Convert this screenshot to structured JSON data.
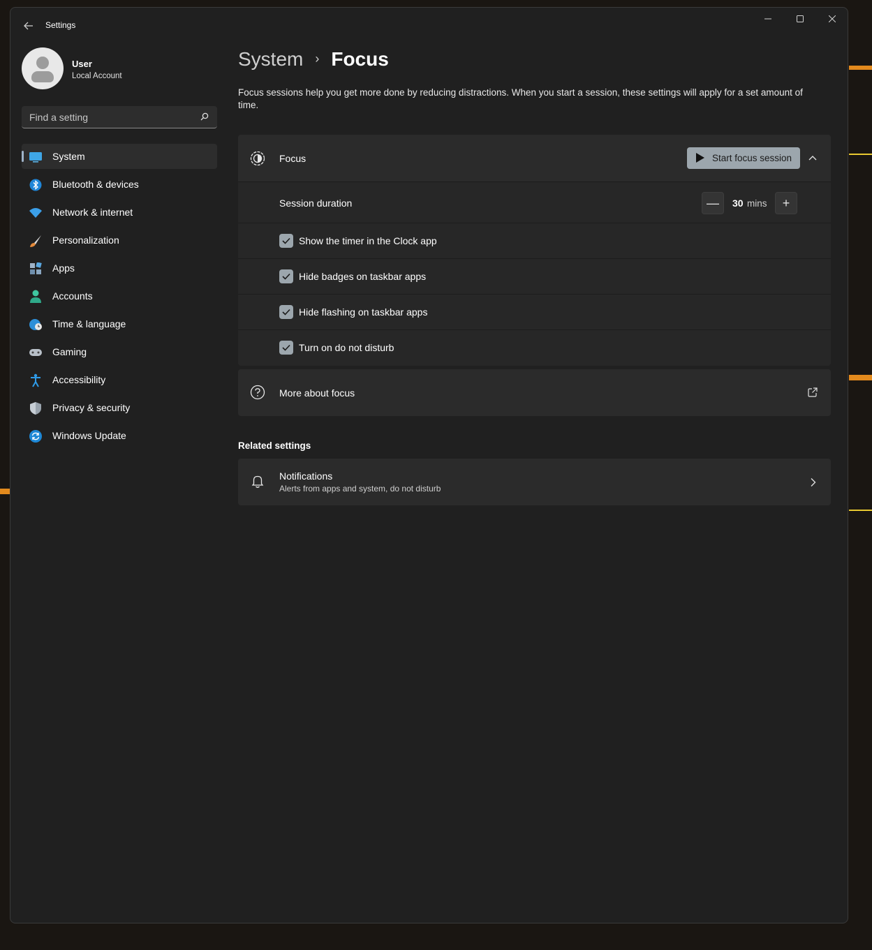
{
  "window": {
    "title": "Settings",
    "back_icon": "back-arrow-icon",
    "controls": [
      "minimize-icon",
      "maximize-icon",
      "close-icon"
    ]
  },
  "profile": {
    "name": "User",
    "account_type": "Local Account"
  },
  "search": {
    "placeholder": "Find a setting",
    "value": "",
    "icon": "search-icon"
  },
  "sidebar": {
    "items": [
      {
        "label": "System",
        "icon": "system-display-icon",
        "active": true
      },
      {
        "label": "Bluetooth & devices",
        "icon": "bluetooth-icon",
        "active": false
      },
      {
        "label": "Network & internet",
        "icon": "wifi-icon",
        "active": false
      },
      {
        "label": "Personalization",
        "icon": "paintbrush-icon",
        "active": false
      },
      {
        "label": "Apps",
        "icon": "apps-icon",
        "active": false
      },
      {
        "label": "Accounts",
        "icon": "person-icon",
        "active": false
      },
      {
        "label": "Time & language",
        "icon": "globe-clock-icon",
        "active": false
      },
      {
        "label": "Gaming",
        "icon": "gamepad-icon",
        "active": false
      },
      {
        "label": "Accessibility",
        "icon": "accessibility-icon",
        "active": false
      },
      {
        "label": "Privacy & security",
        "icon": "shield-icon",
        "active": false
      },
      {
        "label": "Windows Update",
        "icon": "update-icon",
        "active": false
      }
    ]
  },
  "main": {
    "breadcrumb": {
      "parent": "System",
      "separator": "›",
      "current": "Focus"
    },
    "description": "Focus sessions help you get more done by reducing distractions. When you start a session, these settings will apply for a set amount of time.",
    "focus": {
      "title": "Focus",
      "icon": "focus-icon",
      "start_button": "Start focus session",
      "expanded": true,
      "duration": {
        "label": "Session duration",
        "value": "30",
        "unit": "mins",
        "minus": "—",
        "plus": "+"
      },
      "options": [
        {
          "label": "Show the timer in the Clock app",
          "checked": true
        },
        {
          "label": "Hide badges on taskbar apps",
          "checked": true
        },
        {
          "label": "Hide flashing on taskbar apps",
          "checked": true
        },
        {
          "label": "Turn on do not disturb",
          "checked": true
        }
      ]
    },
    "more": {
      "title": "More about focus",
      "icon": "help-circle-icon",
      "action_icon": "open-external-icon"
    },
    "related": {
      "heading": "Related settings",
      "items": [
        {
          "title": "Notifications",
          "subtitle": "Alerts from apps and system, do not disturb",
          "icon": "bell-icon"
        }
      ]
    }
  },
  "colors": {
    "window_bg": "#202020",
    "card_bg": "#2b2b2b",
    "accent": "#9ca6ad",
    "text": "#ffffff"
  }
}
